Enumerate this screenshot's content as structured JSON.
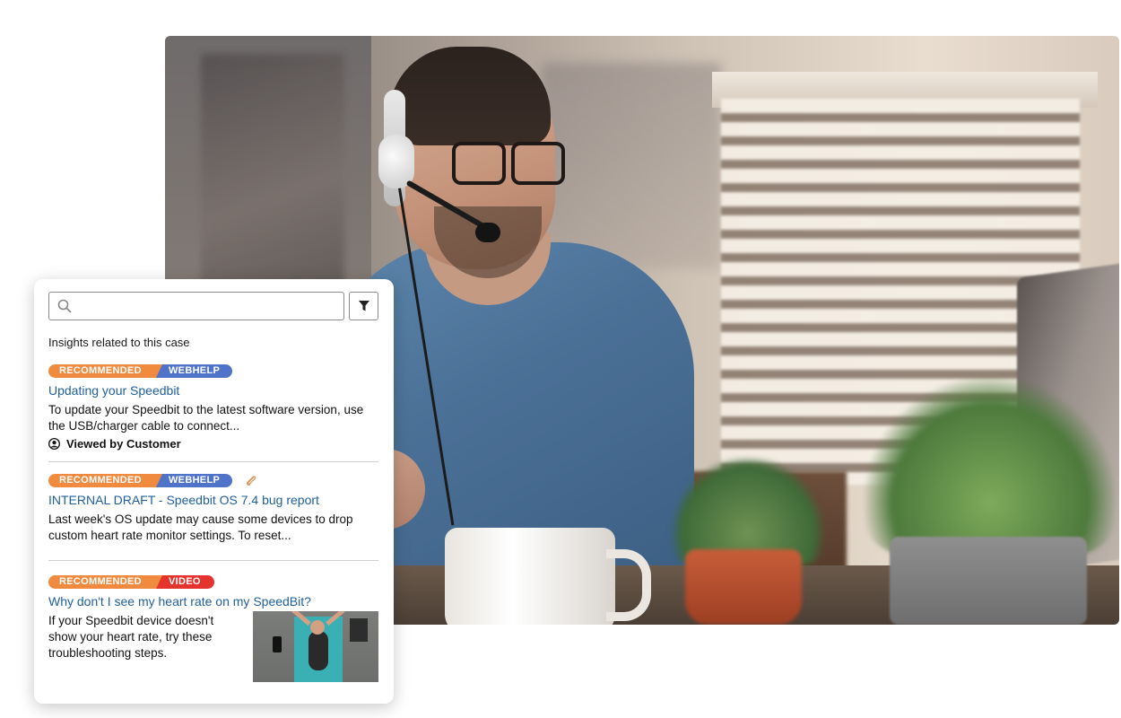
{
  "colors": {
    "link": "#1f5f9e",
    "tag_recommended": "#f08a3e",
    "tag_webhelp": "#4f73c9",
    "tag_video": "#e5342d"
  },
  "search": {
    "placeholder": "",
    "value": ""
  },
  "section_heading": "Insights related to this case",
  "insights": [
    {
      "tags": [
        "RECOMMENDED",
        "WEBHELP"
      ],
      "title": "Updating your Speedbit",
      "description": "To update your Speedbit to the latest software version, use the USB/charger cable to connect...",
      "viewed_label": "Viewed by Customer",
      "icon": "user-icon"
    },
    {
      "tags": [
        "RECOMMENDED",
        "WEBHELP"
      ],
      "title": "INTERNAL DRAFT - Speedbit OS 7.4 bug report",
      "description": "Last week's OS update may cause some devices to drop custom heart rate monitor settings. To reset...",
      "icon": "paperclip-icon"
    },
    {
      "tags": [
        "RECOMMENDED",
        "VIDEO"
      ],
      "title": "Why don't I see my heart rate on my SpeedBit?",
      "description": "If your Speedbit device doesn't show your heart rate, try these troubleshooting steps.",
      "icon": "video-thumbnail"
    }
  ]
}
